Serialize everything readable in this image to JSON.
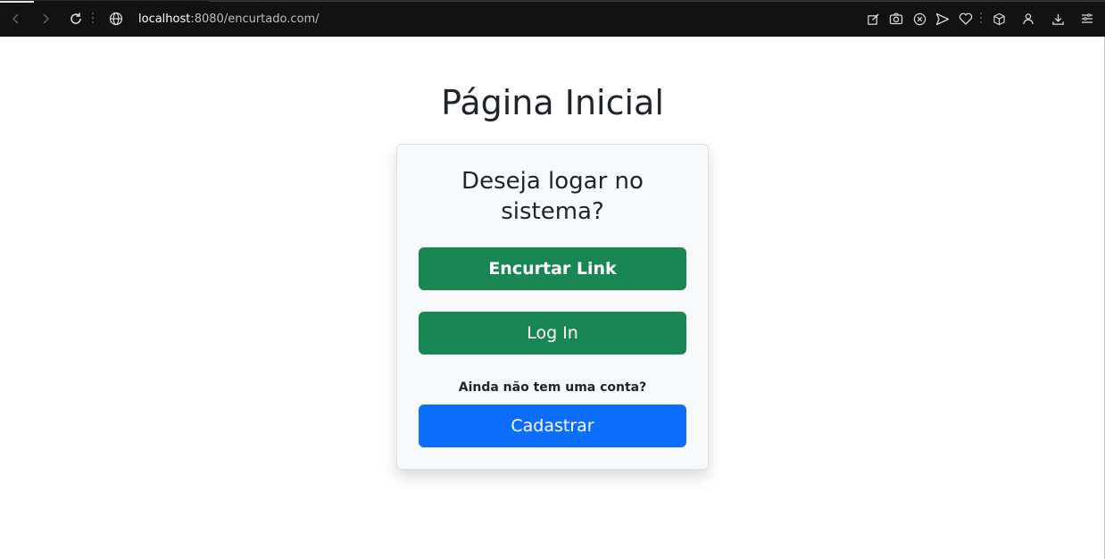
{
  "browser": {
    "url_host": "localhost",
    "url_rest": ":8080/encurtado.com/",
    "icons": [
      "back-icon",
      "forward-icon",
      "reload-icon",
      "globe-icon",
      "edit-icon",
      "camera-icon",
      "close-circle-icon",
      "send-icon",
      "heart-icon",
      "cube-icon",
      "user-icon",
      "download-icon",
      "menu-icon"
    ]
  },
  "page": {
    "title": "Página Inicial"
  },
  "card": {
    "title": "Deseja logar no sistema?",
    "shorten_label": "Encurtar Link",
    "login_label": "Log In",
    "no_account_text": "Ainda não tem uma conta?",
    "register_label": "Cadastrar"
  },
  "colors": {
    "green": "#198754",
    "blue": "#0d6efd",
    "card_bg": "#f8f9fa",
    "text": "#212529"
  }
}
